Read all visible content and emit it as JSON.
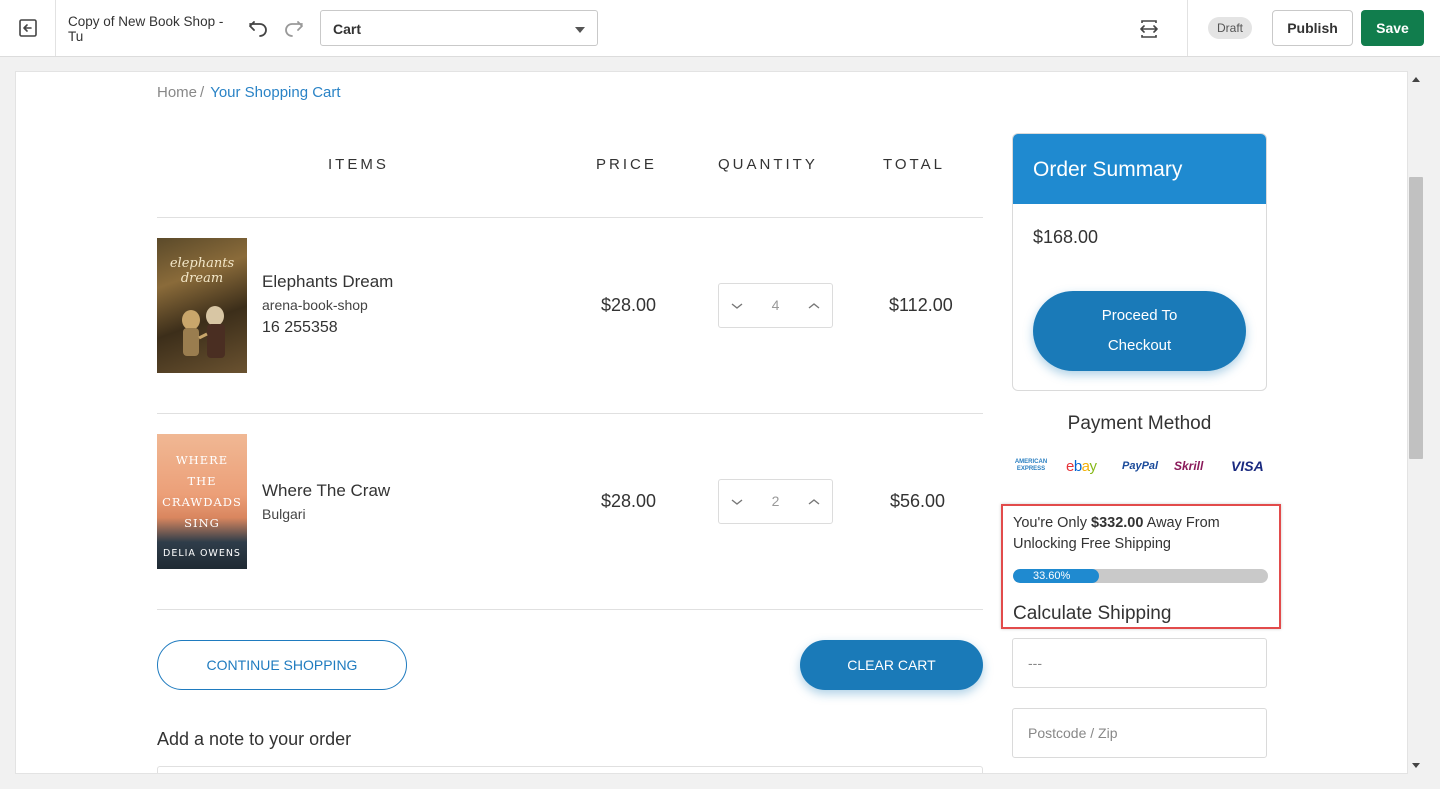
{
  "editor": {
    "doc_title": "Copy of New Book Shop - Tu",
    "page_select": "Cart",
    "status_badge": "Draft",
    "publish_label": "Publish",
    "save_label": "Save"
  },
  "breadcrumb": {
    "home": "Home",
    "separator": "/",
    "current": "Your Shopping Cart"
  },
  "cart": {
    "headers": {
      "items": "ITEMS",
      "price": "PRICE",
      "quantity": "QUANTITY",
      "total": "TOTAL"
    },
    "items": [
      {
        "name": "Elephants Dream",
        "vendor": "arena-book-shop",
        "code": "16 255358",
        "price": "$28.00",
        "quantity": "4",
        "total": "$112.00",
        "cover_title": "elephants dream"
      },
      {
        "name": "Where The Craw",
        "vendor": "Bulgari",
        "price": "$28.00",
        "quantity": "2",
        "total": "$56.00",
        "cover_title_lines": [
          "WHERE",
          "THE",
          "CRAWDADS",
          "SING"
        ],
        "cover_author": "DELIA OWENS"
      }
    ],
    "continue_label": "CONTINUE SHOPPING",
    "clear_label": "CLEAR CART",
    "note_label": "Add a note to your order"
  },
  "summary": {
    "title": "Order Summary",
    "amount": "$168.00",
    "checkout_line1": "Proceed To",
    "checkout_line2": "Checkout"
  },
  "payment": {
    "title": "Payment Method",
    "logos": [
      "AMERICAN EXPRESS",
      "ebay",
      "PayPal",
      "Skrill",
      "VISA"
    ]
  },
  "free_shipping": {
    "prefix": "You're Only ",
    "amount": "$332.00",
    "suffix": " Away From Unlocking Free Shipping",
    "progress_label": "33.60%",
    "progress_percent": 33.6,
    "calc_title": "Calculate Shipping"
  },
  "shipping_form": {
    "country_placeholder": "---",
    "postcode_placeholder": "Postcode / Zip"
  },
  "colors": {
    "accent": "#1f8ad0",
    "button": "#1a7ab8",
    "save": "#117d4d",
    "highlight": "#e24b4b"
  }
}
